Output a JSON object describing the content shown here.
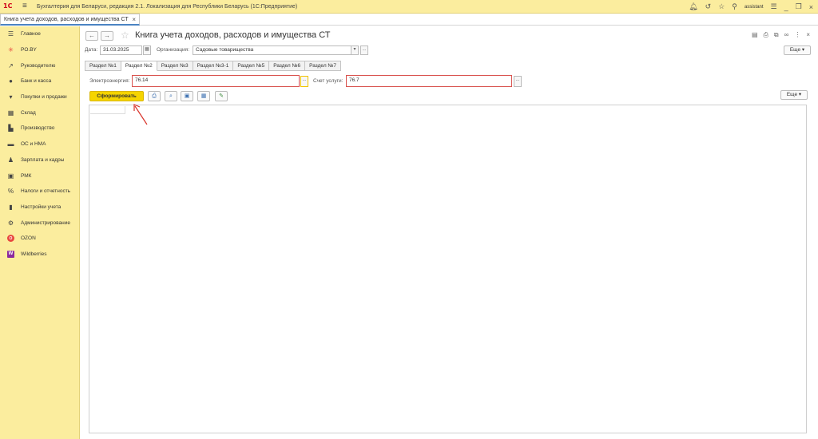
{
  "titlebar": {
    "logo": "1С",
    "app_title": "Бухгалтерия для Беларуси, редакция 2.1. Локализация для Республики Беларусь  (1С:Предприятие)",
    "user": "assistant"
  },
  "tab": {
    "label": "Книга учета доходов, расходов и имущества СТ"
  },
  "sidebar": {
    "items": [
      {
        "label": "Главное",
        "icon": "menu-lines-icon"
      },
      {
        "label": "PO.BY",
        "icon": "sparkle-icon"
      },
      {
        "label": "Руководителю",
        "icon": "trend-icon"
      },
      {
        "label": "Банк и касса",
        "icon": "bank-icon"
      },
      {
        "label": "Покупки и продажи",
        "icon": "cart-icon"
      },
      {
        "label": "Склад",
        "icon": "warehouse-icon"
      },
      {
        "label": "Производство",
        "icon": "factory-icon"
      },
      {
        "label": "ОС и НМА",
        "icon": "truck-icon"
      },
      {
        "label": "Зарплата и кадры",
        "icon": "person-icon"
      },
      {
        "label": "РМК",
        "icon": "register-icon"
      },
      {
        "label": "Налоги и отчетность",
        "icon": "percent-icon"
      },
      {
        "label": "Настройки учета",
        "icon": "book-icon"
      },
      {
        "label": "Администрирование",
        "icon": "gear-icon"
      },
      {
        "label": "OZON",
        "icon": "ozon-icon"
      },
      {
        "label": "Wildberries",
        "icon": "wildberries-icon"
      }
    ]
  },
  "form": {
    "title": "Книга учета доходов, расходов и имущества СТ",
    "more_label": "Еще",
    "date_label": "Дата:",
    "date_value": "31.03.2025",
    "org_label": "Организация:",
    "org_value": "Садовые товарищества",
    "tabs": [
      "Раздел №1",
      "Раздел №2",
      "Раздел №3",
      "Раздел №3-1",
      "Раздел №5",
      "Раздел №6",
      "Раздел №7"
    ],
    "active_tab": "Раздел №2",
    "electricity_label": "Электроэнергия:",
    "electricity_value": "76.14",
    "services_label": "Счет услуги:",
    "services_value": "76.7",
    "generate_label": "Сформировать",
    "ellipsis": "..."
  }
}
